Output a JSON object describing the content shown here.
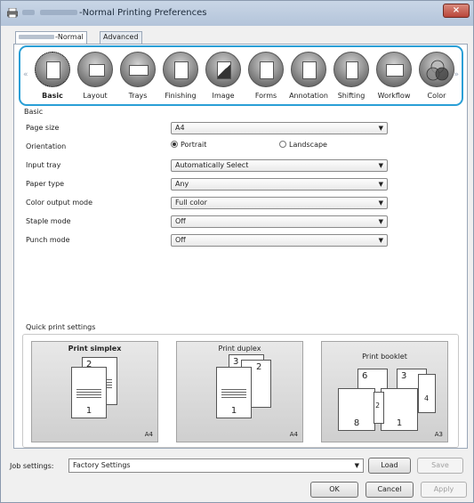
{
  "window": {
    "title": "-Normal Printing Preferences",
    "close_label": "×"
  },
  "tabs": [
    {
      "label": "-Normal"
    },
    {
      "label": "Advanced"
    }
  ],
  "features": [
    {
      "label": "Basic",
      "icon": "basic-page-icon"
    },
    {
      "label": "Layout",
      "icon": "layout-icon"
    },
    {
      "label": "Trays",
      "icon": "trays-icon"
    },
    {
      "label": "Finishing",
      "icon": "finishing-icon"
    },
    {
      "label": "Image",
      "icon": "image-icon"
    },
    {
      "label": "Forms",
      "icon": "forms-icon"
    },
    {
      "label": "Annotation",
      "icon": "annotation-icon"
    },
    {
      "label": "Shifting",
      "icon": "shifting-icon"
    },
    {
      "label": "Workflow",
      "icon": "workflow-icon"
    },
    {
      "label": "Color",
      "icon": "color-icon"
    }
  ],
  "strip": {
    "left_arrow": "«",
    "right_arrow": "»"
  },
  "basic": {
    "section_title": "Basic",
    "page_size": {
      "label": "Page size",
      "value": "A4"
    },
    "orientation": {
      "label": "Orientation",
      "portrait": "Portrait",
      "landscape": "Landscape"
    },
    "input_tray": {
      "label": "Input tray",
      "value": "Automatically Select"
    },
    "paper_type": {
      "label": "Paper type",
      "value": "Any"
    },
    "color_mode": {
      "label": "Color output mode",
      "value": "Full color"
    },
    "staple_mode": {
      "label": "Staple mode",
      "value": "Off"
    },
    "punch_mode": {
      "label": "Punch mode",
      "value": "Off"
    }
  },
  "quick_print": {
    "title": "Quick print settings",
    "cards": [
      {
        "title": "Print simplex",
        "size": "A4",
        "nums": [
          "2",
          "1"
        ]
      },
      {
        "title": "Print duplex",
        "size": "A4",
        "nums": [
          "3",
          "2",
          "1"
        ]
      },
      {
        "title": "Print booklet",
        "size": "A3",
        "nums": [
          "6",
          "3",
          "8",
          "1",
          "2",
          "4"
        ]
      }
    ]
  },
  "job": {
    "label": "Job settings:",
    "value": "Factory Settings",
    "load": "Load",
    "save": "Save"
  },
  "footer": {
    "ok": "OK",
    "cancel": "Cancel",
    "apply": "Apply"
  },
  "colors": {
    "accent": "#2a9fd6",
    "close": "#b9463a"
  }
}
